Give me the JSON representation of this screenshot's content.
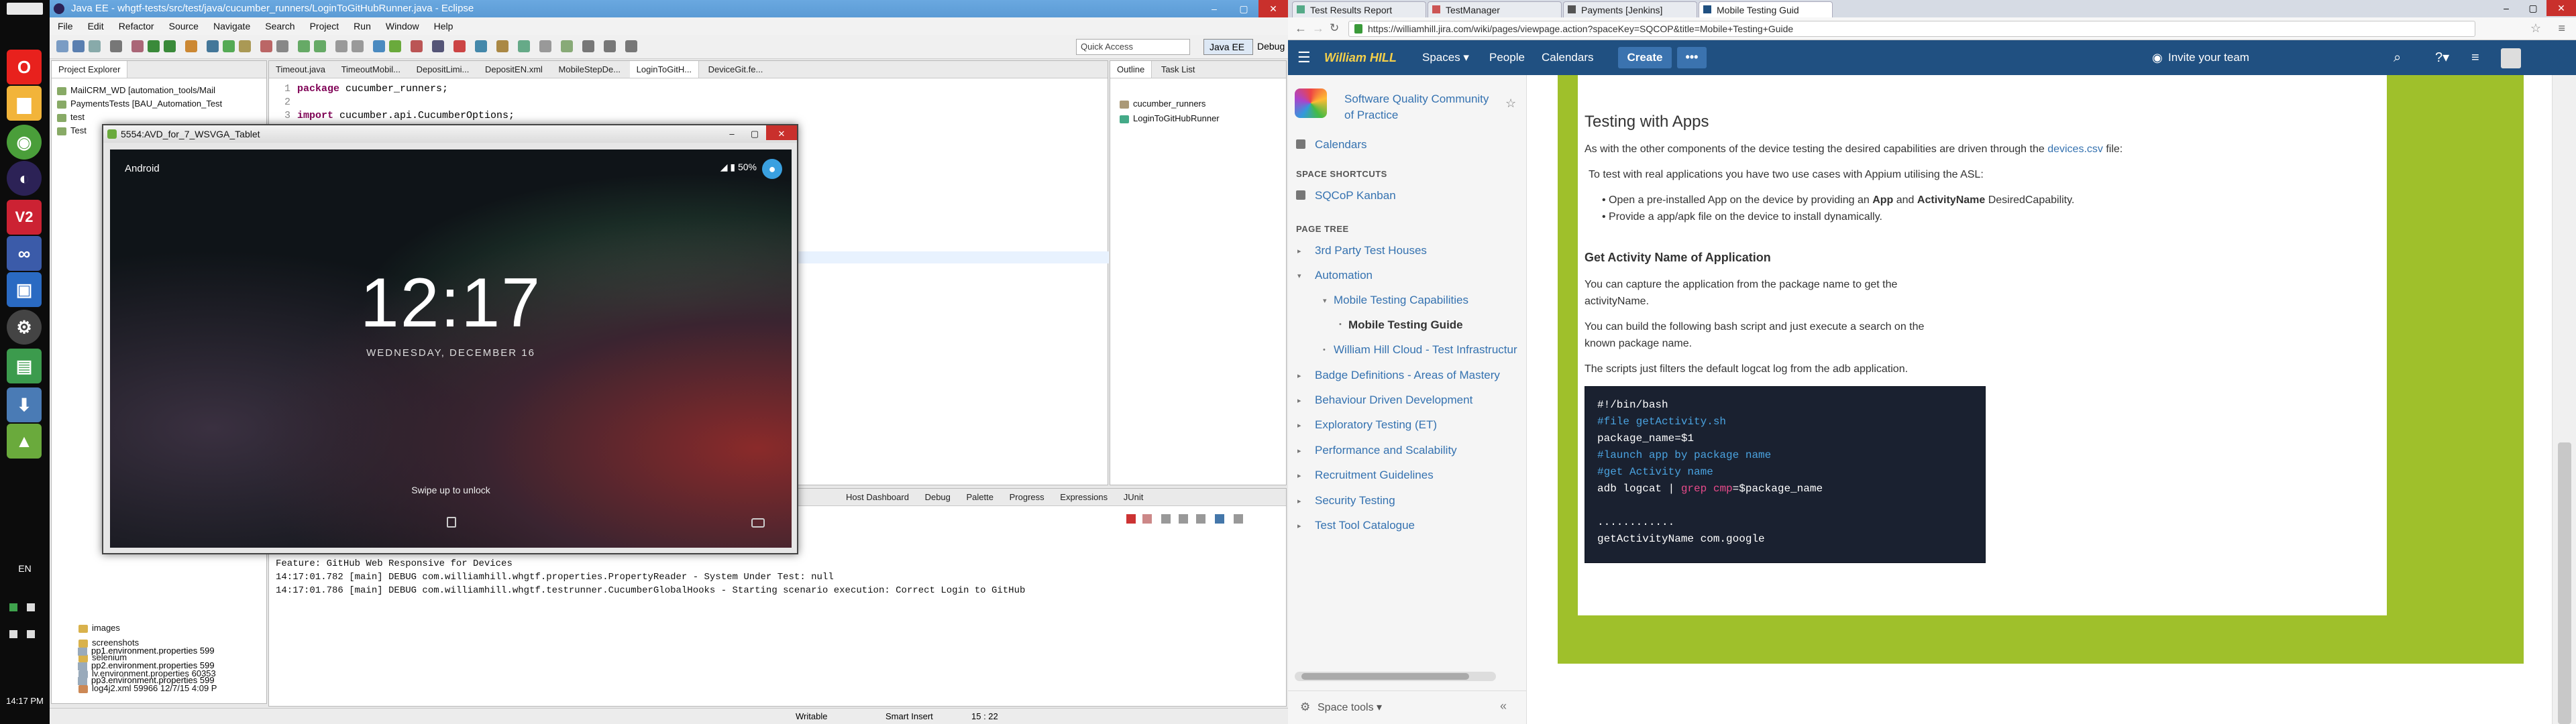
{
  "taskbar": {
    "language": "EN",
    "time": "14:17 PM",
    "apps": [
      {
        "icon": "opera-icon",
        "color": "#e8211d",
        "glyph": "O"
      },
      {
        "icon": "folder-icon",
        "color": "#f2b43a",
        "glyph": "▆"
      },
      {
        "icon": "chrome-icon",
        "color": "#4a9e3a",
        "glyph": "◉"
      },
      {
        "icon": "eclipse-icon",
        "color": "#2c2256",
        "glyph": "◐"
      },
      {
        "icon": "vnc-icon",
        "color": "#cc2233",
        "glyph": "V2"
      },
      {
        "icon": "infinity-icon",
        "color": "#3b5ba9",
        "glyph": "∞"
      },
      {
        "icon": "remote-desktop-icon",
        "color": "#2a6ac2",
        "glyph": "▣"
      },
      {
        "icon": "settings-icon",
        "color": "#444",
        "glyph": "⚙"
      },
      {
        "icon": "android-sdk-icon",
        "color": "#3c9b4d",
        "glyph": "▤"
      },
      {
        "icon": "download-icon",
        "color": "#4a7bb5",
        "glyph": "⬇"
      },
      {
        "icon": "android-icon",
        "color": "#6aaa3c",
        "glyph": "▲"
      }
    ]
  },
  "eclipse": {
    "title": "Java EE - whgtf-tests/src/test/java/cucumber_runners/LoginToGitHubRunner.java - Eclipse",
    "menu": [
      "File",
      "Edit",
      "Refactor",
      "Source",
      "Navigate",
      "Search",
      "Project",
      "Run",
      "Window",
      "Help"
    ],
    "quick_access": "Quick Access",
    "perspective_active": "Java EE",
    "perspective_other": "Debug",
    "project_explorer": {
      "tab": "Project Explorer",
      "rows_top": [
        "MailCRM_WD [automation_tools/Mail",
        "PaymentsTests [BAU_Automation_Test",
        "test",
        "Test"
      ],
      "rows_bottom": [
        "images",
        "screenshots",
        "selenium",
        "lv.environment.properties 60353",
        "log4j2.xml 59966  12/7/15 4:09 P",
        "pp1.environment.properties 599",
        "pp2.environment.properties 599",
        "pp3.environment.properties 599"
      ]
    },
    "editor_tabs": [
      "Timeout.java",
      "TimeoutMobil...",
      "DepositLimi...",
      "DepositEN.xml",
      "MobileStepDe...",
      "LoginToGitH...",
      "DeviceGit.fe..."
    ],
    "code": [
      {
        "n": "1",
        "kw": "package",
        "rest": " cucumber_runners;"
      },
      {
        "n": "2",
        "kw": "",
        "rest": ""
      },
      {
        "n": "3",
        "kw": "import",
        "rest": " cucumber.api.CucumberOptions;"
      }
    ],
    "outline": {
      "tabs": [
        "Outline",
        "Task List"
      ],
      "items": [
        "cucumber_runners",
        "LoginToGitHubRunner"
      ]
    },
    "console_tabs": [
      "Host Dashboard",
      "Debug",
      "Palette",
      "Progress",
      "Expressions",
      "JUnit"
    ],
    "console": [
      "Feature: GitHub Web Responsive for Devices",
      "14:17:01.782 [main] DEBUG com.williamhill.whgtf.properties.PropertyReader - System Under Test: null",
      "14:17:01.786 [main] DEBUG com.williamhill.whgtf.testrunner.CucumberGlobalHooks - Starting scenario execution: Correct Login to GitHub"
    ],
    "status": {
      "writable": "Writable",
      "insert": "Smart Insert",
      "position": "15 : 22"
    }
  },
  "emulator": {
    "title": "5554:AVD_for_7_WSVGA_Tablet",
    "carrier": "Android",
    "battery": "50%",
    "clock": "12:17",
    "date": "WEDNESDAY, DECEMBER 16",
    "swipe": "Swipe up to unlock"
  },
  "browser": {
    "tabs": [
      {
        "label": "Test Results Report",
        "active": false
      },
      {
        "label": "TestManager",
        "active": false
      },
      {
        "label": "Payments [Jenkins]",
        "active": false
      },
      {
        "label": "Mobile Testing Guid",
        "active": true
      }
    ],
    "url": "https://williamhill.jira.com/wiki/pages/viewpage.action?spaceKey=SQCOP&title=Mobile+Testing+Guide",
    "header": {
      "logo": "William HILL",
      "spaces": "Spaces ▾",
      "people": "People",
      "calendars": "Calendars",
      "create": "Create",
      "more": "•••",
      "invite": "Invite your team"
    },
    "sidebar": {
      "space_name": "Software Quality Community of Practice",
      "calendars": "Calendars",
      "shortcuts_head": "SPACE SHORTCUTS",
      "shortcut": "SQCoP Kanban",
      "tree_head": "PAGE TREE",
      "tree": [
        {
          "label": "3rd Party Test Houses",
          "indent": 0,
          "arrow": "▸"
        },
        {
          "label": "Automation",
          "indent": 0,
          "arrow": "▾"
        },
        {
          "label": "Mobile Testing Capabilities",
          "indent": 1,
          "arrow": "▾"
        },
        {
          "label": "Mobile Testing Guide",
          "indent": 2,
          "arrow": "•",
          "current": true
        },
        {
          "label": "William Hill Cloud - Test Infrastructur",
          "indent": 1,
          "arrow": "•"
        },
        {
          "label": "Badge Definitions - Areas of Mastery",
          "indent": 0,
          "arrow": "▸"
        },
        {
          "label": "Behaviour Driven Development",
          "indent": 0,
          "arrow": "▸"
        },
        {
          "label": "Exploratory Testing (ET)",
          "indent": 0,
          "arrow": "▸"
        },
        {
          "label": "Performance and Scalability",
          "indent": 0,
          "arrow": "▸"
        },
        {
          "label": "Recruitment Guidelines",
          "indent": 0,
          "arrow": "▸"
        },
        {
          "label": "Security Testing",
          "indent": 0,
          "arrow": "▸"
        },
        {
          "label": "Test Tool Catalogue",
          "indent": 0,
          "arrow": "▸"
        }
      ],
      "space_tools": "Space tools ▾",
      "collapse": "«"
    },
    "content": {
      "heading": "Testing with Apps",
      "p1_pre": "As with the other components of the device testing the desired capabilities are driven through the ",
      "p1_link": "devices.csv",
      "p1_post": " file:",
      "p2": "To test with real applications you have two use cases with Appium utilising the ASL:",
      "li1_pre": "Open a pre-installed App on the device by providing an ",
      "li1_b1": "App",
      "li1_mid": " and ",
      "li1_b2": "ActivityName",
      "li1_post": " DesiredCapability.",
      "li2": "Provide a app/apk file on the device to install dynamically.",
      "h3": "Get Activity Name of Application",
      "p3a": "You can capture the application from the package name to get the",
      "p3b": "activityName.",
      "p4a": "You can build the following bash script and just execute a search on the",
      "p4b": "known package name.",
      "p5": "The scripts just filters the default logcat log from the adb application.",
      "code": {
        "l1": "#!/bin/bash",
        "l2": "#file getActivity.sh",
        "l3": "package_name=$1",
        "l4": "#launch app by package name",
        "l5": "#get Activity name",
        "l6a": "adb logcat | ",
        "l6b": "grep cmp",
        "l6c": "=$package_name",
        "l7": "............",
        "l8": "getActivityName com.google"
      }
    }
  }
}
